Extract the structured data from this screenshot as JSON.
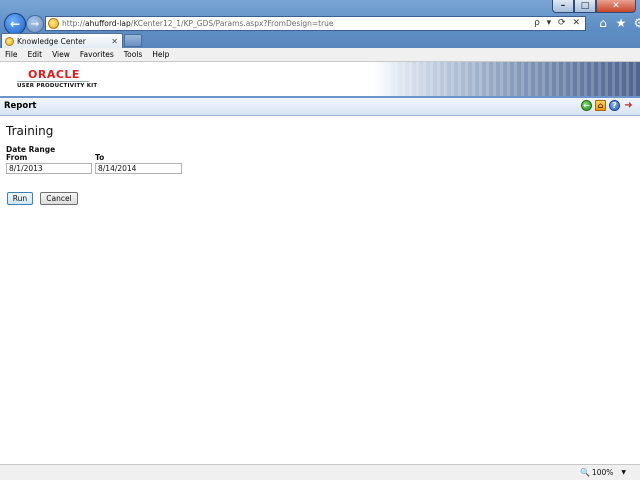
{
  "browser": {
    "url_prefix": "http://",
    "url_host": "ahufford-lap",
    "url_path": "/KCenter12_1/KP_GDS/Params.aspx?FromDesign=true",
    "address_tools": "ρ ▾ ⟳ ✕",
    "tab_title": "Knowledge Center",
    "tab_close": "✕",
    "back_glyph": "←",
    "forward_glyph": "→",
    "home_glyph": "⌂",
    "favorites_glyph": "★",
    "tools_glyph": "⚙",
    "window_minimize": "–",
    "window_maximize": "□",
    "window_close": "✕"
  },
  "menu": {
    "items": [
      "File",
      "Edit",
      "View",
      "Favorites",
      "Tools",
      "Help"
    ]
  },
  "banner": {
    "brand": "ORACLE",
    "product": "USER PRODUCTIVITY KIT"
  },
  "report_bar": {
    "title": "Report",
    "icons": [
      "back-icon",
      "home-icon",
      "help-icon",
      "exit-icon"
    ],
    "home_glyph": "⌂",
    "back_glyph": "←",
    "help_glyph": "?",
    "exit_glyph": "➜"
  },
  "form": {
    "heading": "Training",
    "date_range_label": "Date Range",
    "from_label": "From",
    "to_label": "To",
    "from_value": "8/1/2013",
    "to_value": "8/14/2014",
    "run_label": "Run",
    "cancel_label": "Cancel"
  },
  "status": {
    "zoom": "100%",
    "zoom_glyph": "🔍",
    "zoom_caret": "▼"
  },
  "colors": {
    "chrome_blue": "#5e8fc4",
    "report_bar": "#d6e3f3",
    "oracle_red": "#e01d1d"
  }
}
